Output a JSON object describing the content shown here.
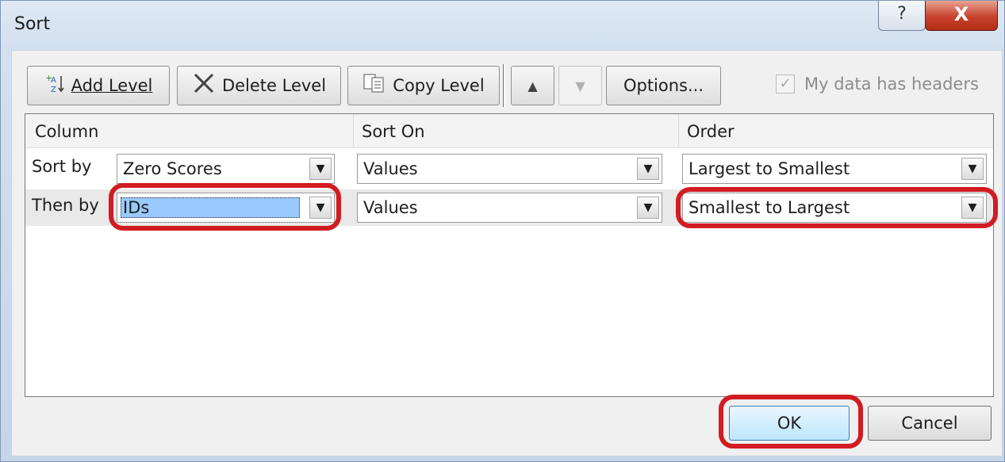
{
  "window": {
    "title": "Sort",
    "help_symbol": "?",
    "close_symbol": "X"
  },
  "toolbar": {
    "add_level": "Add Level",
    "delete_level": "Delete Level",
    "copy_level": "Copy Level",
    "move_up_symbol": "▲",
    "move_down_symbol": "▼",
    "options": "Options...",
    "headers_checkbox_label": "My data has headers",
    "headers_checked": true
  },
  "grid": {
    "headers": {
      "column": "Column",
      "sort_on": "Sort On",
      "order": "Order"
    },
    "rows": [
      {
        "label": "Sort by",
        "column": "Zero Scores",
        "sort_on": "Values",
        "order": "Largest to Smallest"
      },
      {
        "label": "Then by",
        "column": "IDs",
        "sort_on": "Values",
        "order": "Smallest to Largest"
      }
    ]
  },
  "icons": {
    "add_level": "sort-az-plus-icon",
    "delete_level": "x-icon",
    "copy_level": "copy-icon",
    "dropdown": "chevron-down-icon"
  },
  "highlight_color": "#d01c22",
  "buttons": {
    "ok": "OK",
    "cancel": "Cancel"
  }
}
